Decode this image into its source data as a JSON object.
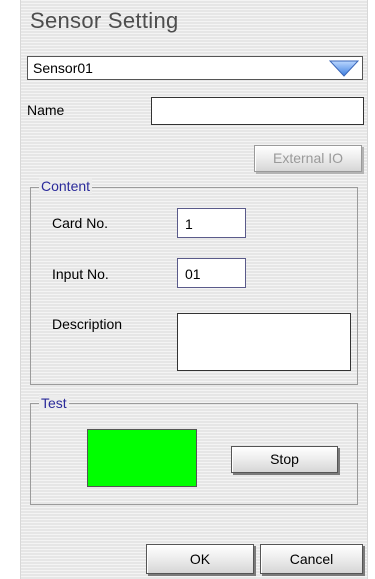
{
  "dialog": {
    "title": "Sensor Setting",
    "sensor_select": {
      "value": "Sensor01"
    },
    "name": {
      "label": "Name",
      "value": ""
    },
    "external_io_button": "External IO",
    "content_group": {
      "legend": "Content",
      "card_no": {
        "label": "Card No.",
        "value": "1"
      },
      "input_no": {
        "label": "Input No.",
        "value": "01"
      },
      "description": {
        "label": "Description",
        "value": ""
      }
    },
    "test_group": {
      "legend": "Test",
      "indicator_color": "#00ff00",
      "stop_button": "Stop"
    },
    "ok_button": "OK",
    "cancel_button": "Cancel"
  }
}
